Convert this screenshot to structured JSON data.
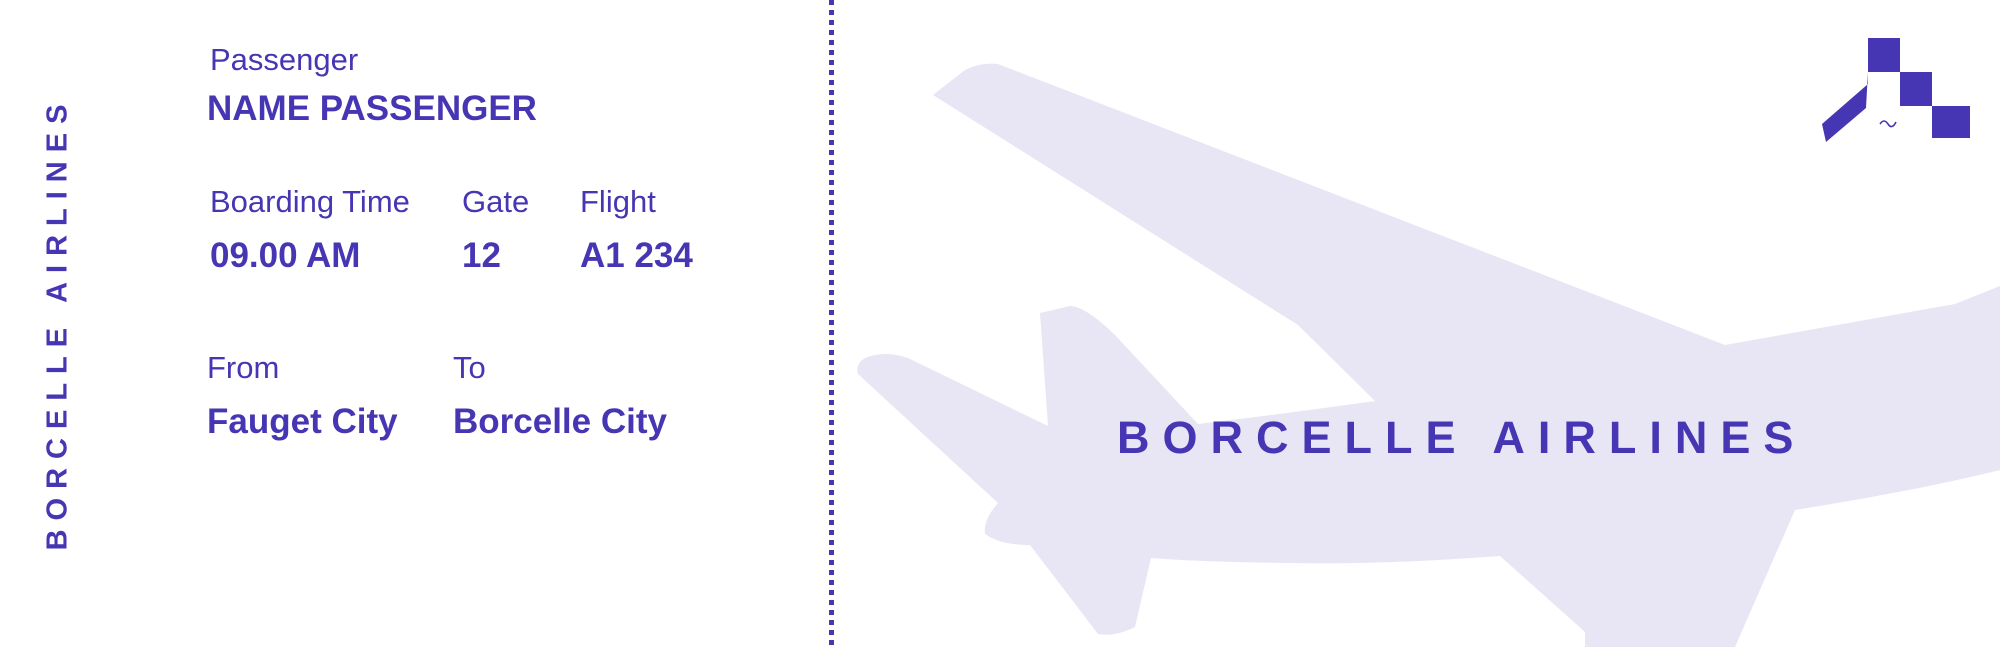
{
  "ticket": {
    "side_brand": "BORCELLE AIRLINES",
    "brand": "BORCELLE AIRLINES",
    "passenger": {
      "label": "Passenger",
      "value": "NAME PASSENGER"
    },
    "boarding_time": {
      "label": "Boarding Time",
      "value": "09.00 AM"
    },
    "gate": {
      "label": "Gate",
      "value": "12"
    },
    "flight": {
      "label": "Flight",
      "value": "A1 234"
    },
    "from": {
      "label": "From",
      "value": "Fauget City"
    },
    "to": {
      "label": "To",
      "value": "Borcelle City"
    }
  },
  "colors": {
    "accent": "#4636b3",
    "plane_fill": "#e8e6f5",
    "background": "#ffffff"
  },
  "icons": {
    "logo": "pixel-a-logo-icon",
    "plane": "airplane-silhouette-icon"
  }
}
